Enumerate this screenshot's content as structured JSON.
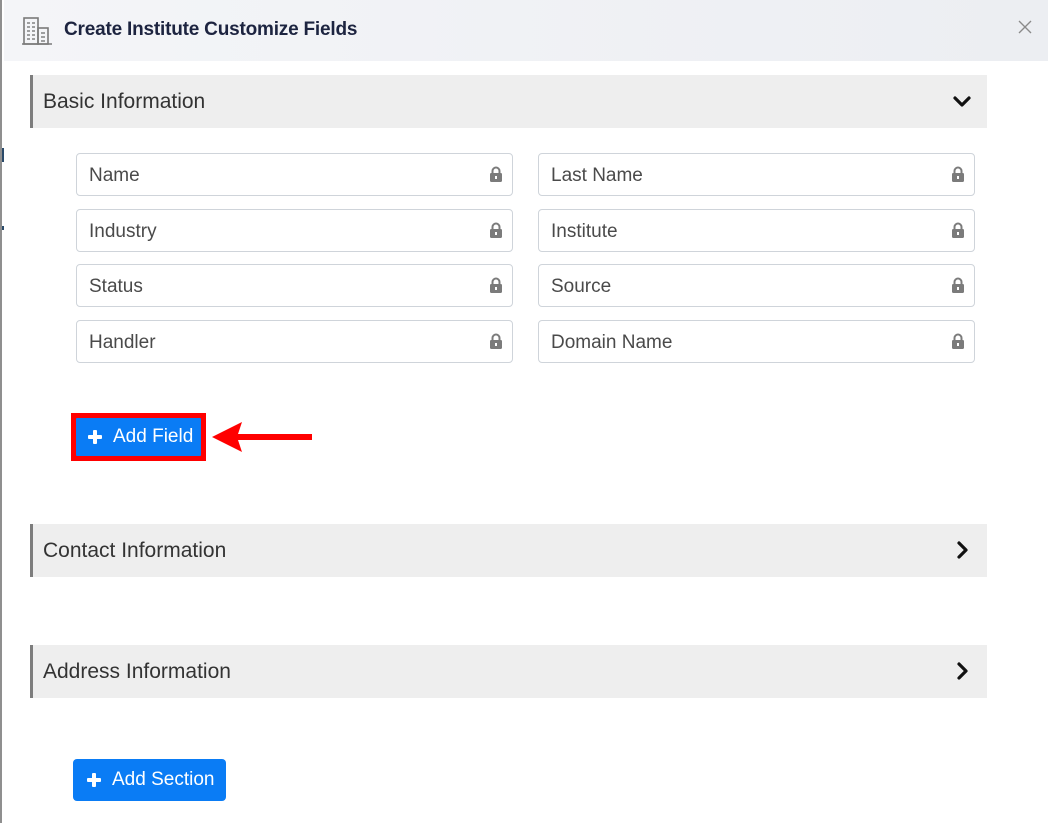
{
  "modal": {
    "title": "Create Institute Customize Fields",
    "header_icon": "building-icon",
    "close_icon": "close-icon"
  },
  "sections": [
    {
      "label": "Basic Information",
      "expanded": true,
      "chevron": "chevron-down-icon",
      "fields": [
        {
          "label": "Name",
          "locked": true
        },
        {
          "label": "Last Name",
          "locked": true
        },
        {
          "label": "Industry",
          "locked": true
        },
        {
          "label": "Institute",
          "locked": true
        },
        {
          "label": "Status",
          "locked": true
        },
        {
          "label": "Source",
          "locked": true
        },
        {
          "label": "Handler",
          "locked": true
        },
        {
          "label": "Domain Name",
          "locked": true
        }
      ],
      "add_field_label": "Add Field"
    },
    {
      "label": "Contact Information",
      "expanded": false,
      "chevron": "chevron-right-icon"
    },
    {
      "label": "Address Information",
      "expanded": false,
      "chevron": "chevron-right-icon"
    }
  ],
  "add_section_label": "Add Section",
  "annotation": {
    "highlight_color": "#ff0000",
    "arrow_color": "#ff0000",
    "target": "Add Field"
  },
  "colors": {
    "primary_button": "#0a7cf5",
    "section_bg": "#eeeeee",
    "title_text": "#1d2440"
  }
}
